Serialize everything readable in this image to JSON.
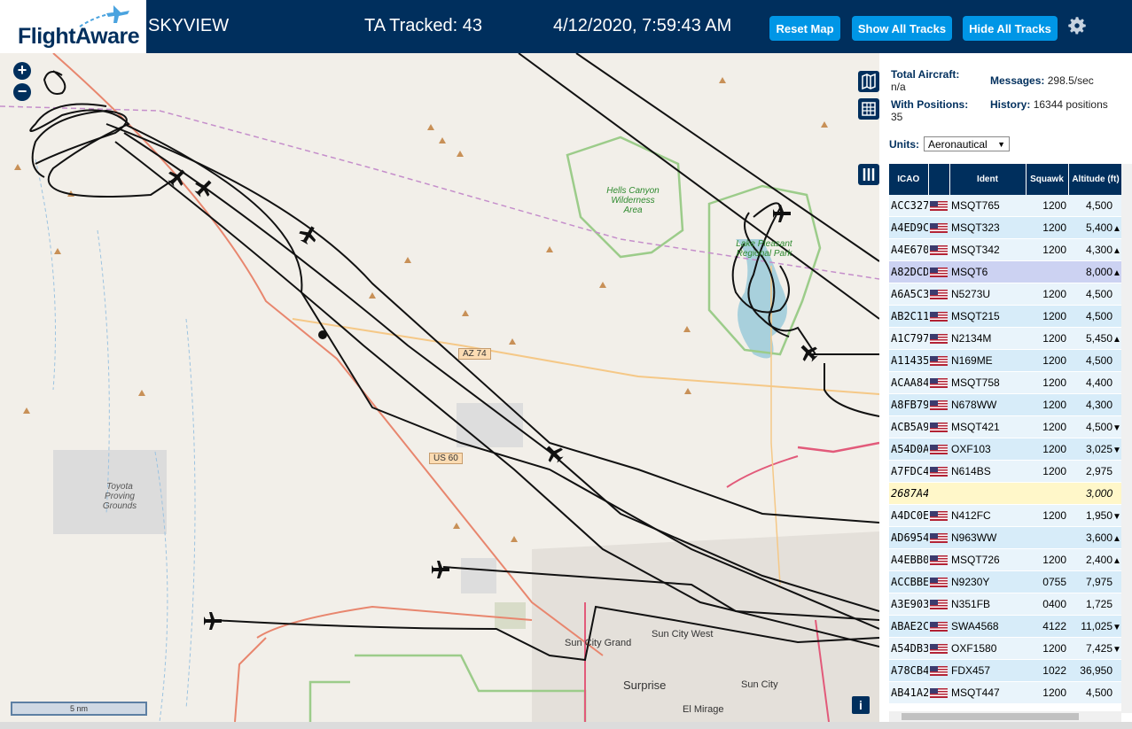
{
  "header": {
    "logo": "FlightAware",
    "title": "SKYVIEW",
    "tracked": "TA Tracked: 43",
    "datetime": "4/12/2020, 7:59:43 AM",
    "buttons": {
      "reset": "Reset Map",
      "show_all": "Show All Tracks",
      "hide_all": "Hide All Tracks"
    }
  },
  "map": {
    "zoom_in": "+",
    "zoom_out": "−",
    "scale": "5 nm",
    "info": "i",
    "labels": {
      "hells_canyon": "Hells Canyon Wilderness Area",
      "lake_pleasant": "Lake Pleasant Regional Park",
      "toyota": "Toyota Proving Grounds",
      "sun_city_grand": "Sun City Grand",
      "sun_city_west": "Sun City West",
      "surprise": "Surprise",
      "sun_city": "Sun City",
      "el_mirage": "El Mirage"
    },
    "shields": {
      "az74": "AZ 74",
      "us60": "US 60"
    }
  },
  "stats": {
    "total_label": "Total Aircraft:",
    "total_value": "n/a",
    "messages_label": "Messages:",
    "messages_value": "298.5/sec",
    "positions_label": "With Positions:",
    "positions_value": "35",
    "history_label": "History:",
    "history_value": "16344 positions",
    "units_label": "Units:",
    "units_value": "Aeronautical"
  },
  "table": {
    "headers": [
      "ICAO",
      "",
      "Ident",
      "Squawk",
      "Altitude (ft)"
    ],
    "rows": [
      {
        "icao": "ACC327",
        "flag": true,
        "ident": "MSQT765",
        "squawk": "1200",
        "alt": "4,500",
        "trend": ""
      },
      {
        "icao": "A4ED9C",
        "flag": true,
        "ident": "MSQT323",
        "squawk": "1200",
        "alt": "5,400",
        "trend": "▲"
      },
      {
        "icao": "A4E670",
        "flag": true,
        "ident": "MSQT342",
        "squawk": "1200",
        "alt": "4,300",
        "trend": "▲"
      },
      {
        "icao": "A82DCD",
        "flag": true,
        "ident": "MSQT6",
        "squawk": "",
        "alt": "8,000",
        "trend": "▲",
        "selected": true
      },
      {
        "icao": "A6A5C3",
        "flag": true,
        "ident": "N5273U",
        "squawk": "1200",
        "alt": "4,500",
        "trend": ""
      },
      {
        "icao": "AB2C11",
        "flag": true,
        "ident": "MSQT215",
        "squawk": "1200",
        "alt": "4,500",
        "trend": ""
      },
      {
        "icao": "A1C797",
        "flag": true,
        "ident": "N2134M",
        "squawk": "1200",
        "alt": "5,450",
        "trend": "▲"
      },
      {
        "icao": "A11435",
        "flag": true,
        "ident": "N169ME",
        "squawk": "1200",
        "alt": "4,500",
        "trend": ""
      },
      {
        "icao": "ACAA84",
        "flag": true,
        "ident": "MSQT758",
        "squawk": "1200",
        "alt": "4,400",
        "trend": ""
      },
      {
        "icao": "A8FB79",
        "flag": true,
        "ident": "N678WW",
        "squawk": "1200",
        "alt": "4,300",
        "trend": ""
      },
      {
        "icao": "ACB5A9",
        "flag": true,
        "ident": "MSQT421",
        "squawk": "1200",
        "alt": "4,500",
        "trend": "▼"
      },
      {
        "icao": "A54D0A",
        "flag": true,
        "ident": "OXF103",
        "squawk": "1200",
        "alt": "3,025",
        "trend": "▼"
      },
      {
        "icao": "A7FDC4",
        "flag": true,
        "ident": "N614BS",
        "squawk": "1200",
        "alt": "2,975",
        "trend": ""
      },
      {
        "icao": "2687A4",
        "flag": false,
        "ident": "",
        "squawk": "",
        "alt": "3,000",
        "trend": "",
        "nopos": true
      },
      {
        "icao": "A4DC0E",
        "flag": true,
        "ident": "N412FC",
        "squawk": "1200",
        "alt": "1,950",
        "trend": "▼"
      },
      {
        "icao": "AD6954",
        "flag": true,
        "ident": "N963WW",
        "squawk": "",
        "alt": "3,600",
        "trend": "▲"
      },
      {
        "icao": "A4EBB0",
        "flag": true,
        "ident": "MSQT726",
        "squawk": "1200",
        "alt": "2,400",
        "trend": "▲"
      },
      {
        "icao": "ACCBBE",
        "flag": true,
        "ident": "N9230Y",
        "squawk": "0755",
        "alt": "7,975",
        "trend": ""
      },
      {
        "icao": "A3E903",
        "flag": true,
        "ident": "N351FB",
        "squawk": "0400",
        "alt": "1,725",
        "trend": ""
      },
      {
        "icao": "ABAE2C",
        "flag": true,
        "ident": "SWA4568",
        "squawk": "4122",
        "alt": "11,025",
        "trend": "▼"
      },
      {
        "icao": "A54DB3",
        "flag": true,
        "ident": "OXF1580",
        "squawk": "1200",
        "alt": "7,425",
        "trend": "▼"
      },
      {
        "icao": "A78CB4",
        "flag": true,
        "ident": "FDX457",
        "squawk": "1022",
        "alt": "36,950",
        "trend": ""
      },
      {
        "icao": "AB41A2",
        "flag": true,
        "ident": "MSQT447",
        "squawk": "1200",
        "alt": "4,500",
        "trend": ""
      }
    ]
  },
  "colors": {
    "header": "#002f5d",
    "button": "#0096e6",
    "track": "#111111"
  },
  "icons": [
    "settings-gear-icon",
    "map-layers-icon",
    "grid-icon",
    "columns-icon",
    "aircraft-icon"
  ]
}
